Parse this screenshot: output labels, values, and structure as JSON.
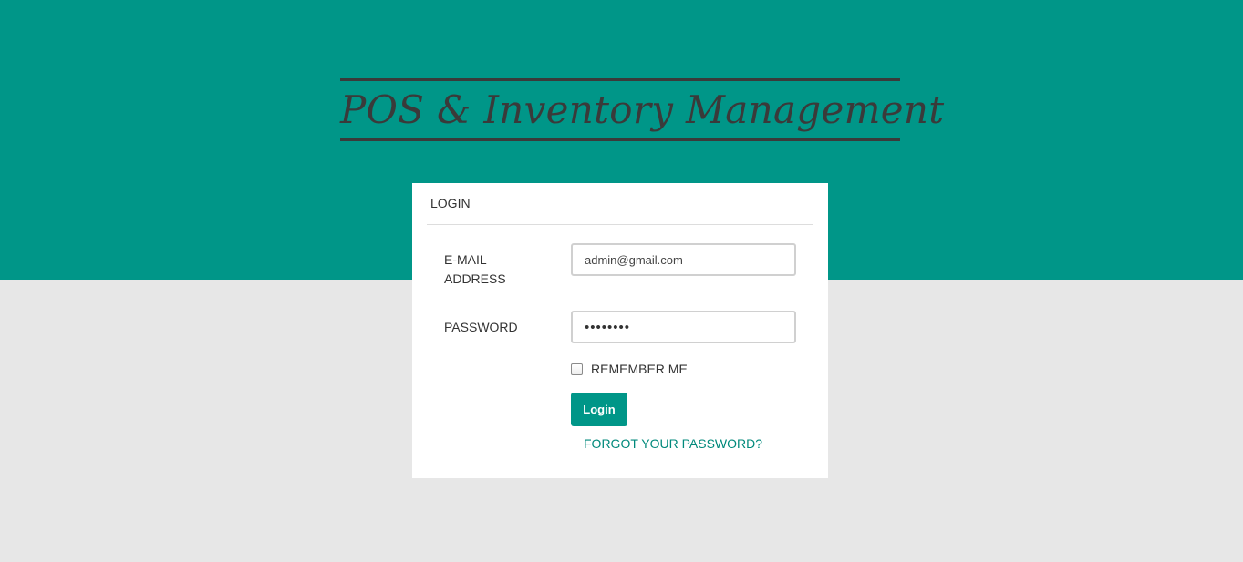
{
  "header": {
    "logo_text": "POS & Inventory Management"
  },
  "login_card": {
    "title": "LOGIN",
    "email": {
      "label": "E-MAIL ADDRESS",
      "value": "admin@gmail.com"
    },
    "password": {
      "label": "PASSWORD",
      "masked_value": "••••••••"
    },
    "remember": {
      "label": "REMEMBER ME",
      "checked": false
    },
    "login_button": "Login",
    "forgot_link": "FORGOT YOUR PASSWORD?"
  },
  "colors": {
    "primary": "#009688",
    "page_background": "#e7e7e7",
    "card_background": "#ffffff",
    "logo_ink": "#3a3a3a"
  }
}
